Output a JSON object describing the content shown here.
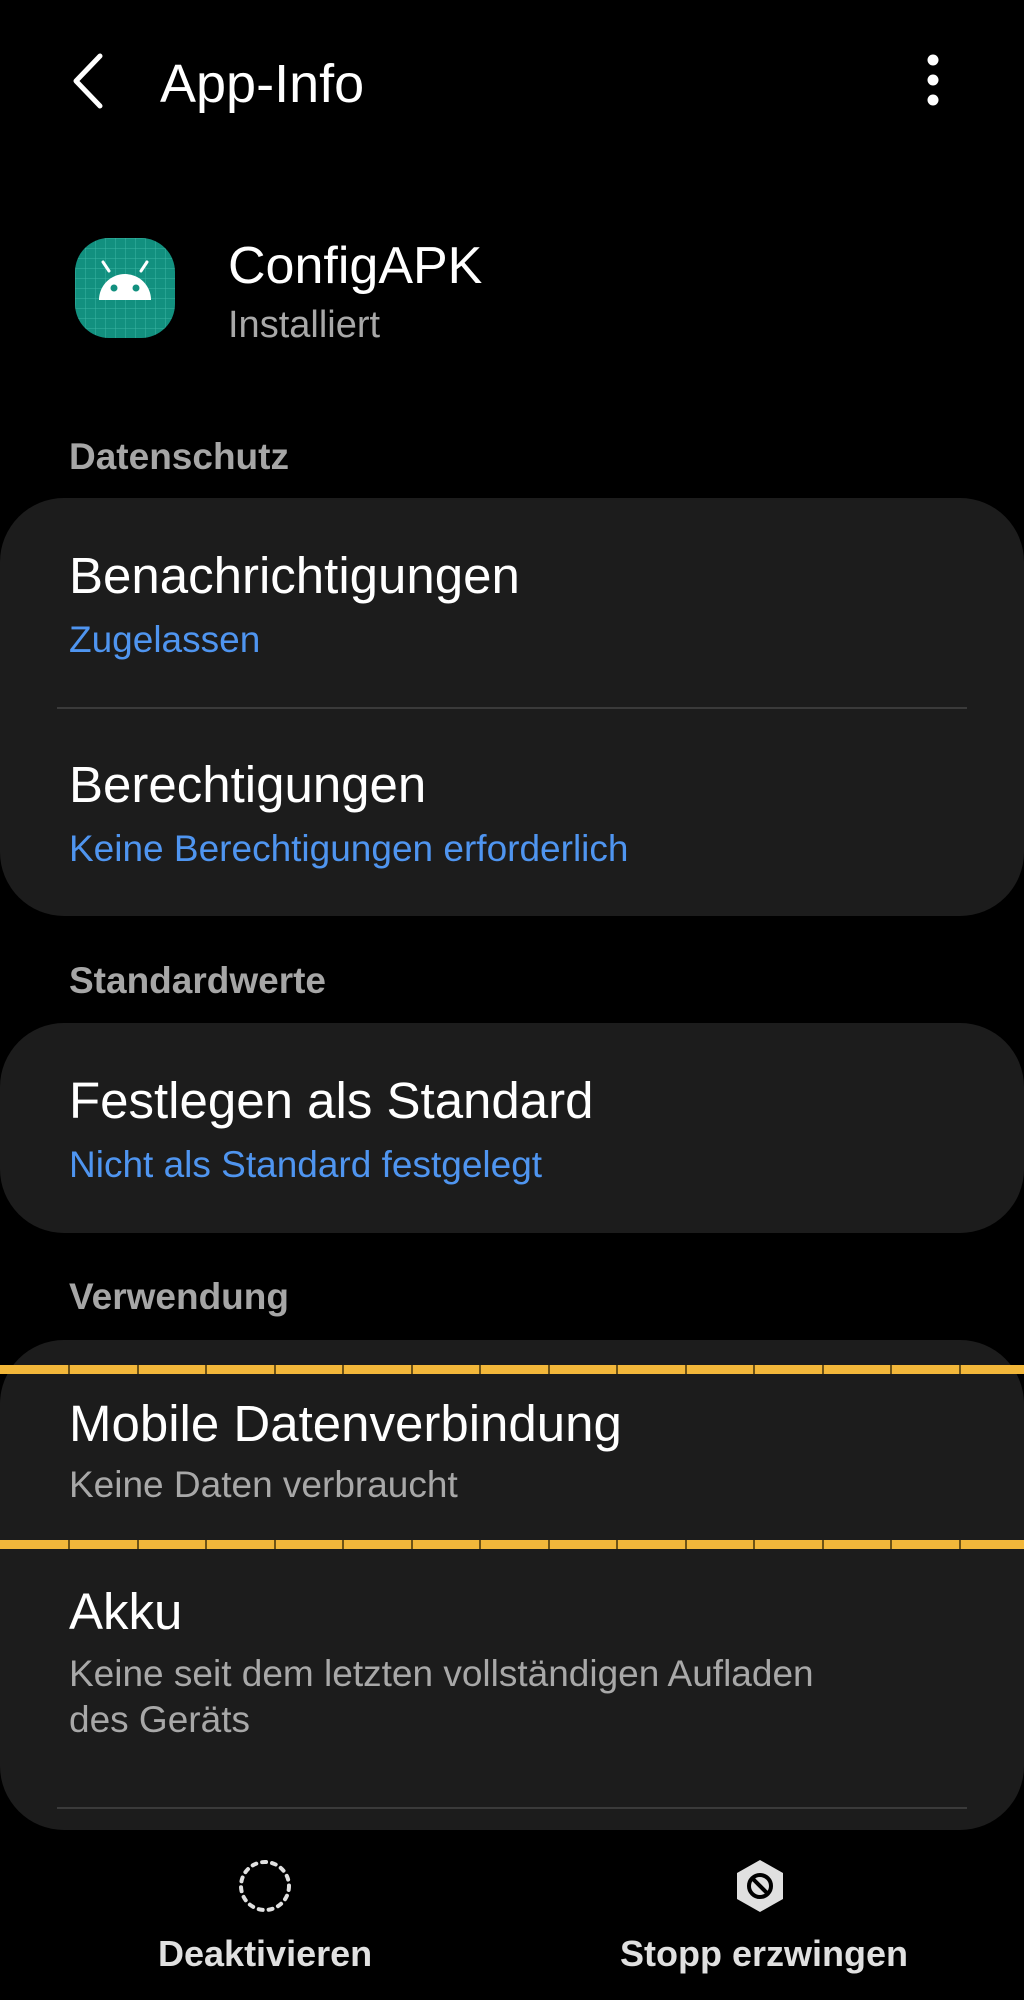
{
  "header": {
    "title": "App-Info",
    "back_icon": "chevron-left-icon",
    "more_icon": "more-vertical-icon"
  },
  "app": {
    "name": "ConfigAPK",
    "status": "Installiert",
    "icon": "android-icon",
    "icon_color": "#1a9a8a"
  },
  "sections": {
    "privacy": {
      "title": "Datenschutz",
      "notifications": {
        "title": "Benachrichtigungen",
        "subtitle": "Zugelassen"
      },
      "permissions": {
        "title": "Berechtigungen",
        "subtitle": "Keine Berechtigungen erforderlich"
      }
    },
    "defaults": {
      "title": "Standardwerte",
      "set_default": {
        "title": "Festlegen als Standard",
        "subtitle": "Nicht als Standard festgelegt"
      }
    },
    "usage": {
      "title": "Verwendung",
      "mobile_data": {
        "title": "Mobile Datenverbindung",
        "subtitle": "Keine Daten verbraucht"
      },
      "battery": {
        "title": "Akku",
        "subtitle_line1": "Keine seit dem letzten vollständigen Aufladen",
        "subtitle_line2": "des Geräts"
      }
    }
  },
  "bottom_actions": {
    "deactivate": {
      "label": "Deaktivieren",
      "icon": "dashed-circle-icon"
    },
    "force_stop": {
      "label": "Stopp erzwingen",
      "icon": "stop-icon"
    }
  },
  "colors": {
    "accent_link": "#4f95f0",
    "card_bg": "#1c1c1c",
    "highlight": "#f2b73a"
  }
}
